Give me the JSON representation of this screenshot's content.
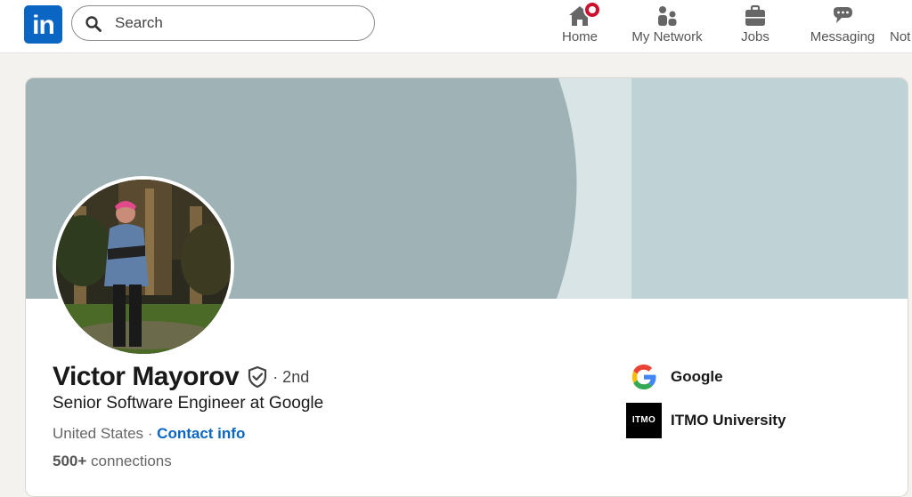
{
  "nav": {
    "logo": "in",
    "search_placeholder": "Search",
    "items": [
      {
        "label": "Home",
        "icon": "home-icon",
        "has_notification": true
      },
      {
        "label": "My Network",
        "icon": "people-icon"
      },
      {
        "label": "Jobs",
        "icon": "briefcase-icon"
      },
      {
        "label": "Messaging",
        "icon": "chat-icon"
      },
      {
        "label": "Not",
        "icon": "bell-icon"
      }
    ]
  },
  "profile": {
    "name": "Victor Mayorov",
    "degree": "· 2nd",
    "headline": "Senior Software Engineer at Google",
    "location": "United States",
    "separator": " · ",
    "contact_info": "Contact info",
    "connections_count": "500+",
    "connections_label": "connections",
    "organizations": [
      {
        "name": "Google",
        "logo": "google-logo"
      },
      {
        "name": "ITMO University",
        "logo": "itmo-logo",
        "logo_text": "ITMO"
      }
    ]
  },
  "colors": {
    "brand": "#0a66c2",
    "banner_main": "#9fb3b6",
    "banner_light": "#d9e4e6",
    "banner_right": "#bfd3d6",
    "notification": "#cb112d"
  }
}
